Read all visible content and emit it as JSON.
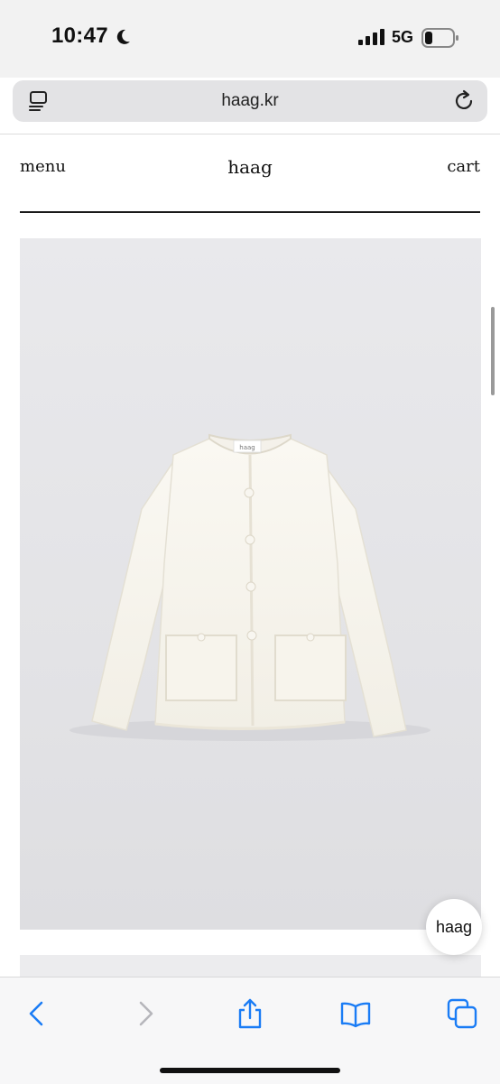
{
  "status": {
    "time": "10:47",
    "network": "5G",
    "icons": [
      "moon-icon",
      "signal-icon",
      "battery-icon"
    ]
  },
  "browser": {
    "url": "haag.kr",
    "icons": [
      "reader-mode-icon",
      "reload-icon"
    ]
  },
  "site": {
    "menu_label": "menu",
    "logo": "haag",
    "cart_label": "cart"
  },
  "product": {
    "image_subject": "white tweed jacket",
    "tag_text": "haag"
  },
  "floating_button": {
    "label": "haag"
  },
  "toolbar": {
    "icons": [
      "back-icon",
      "forward-icon",
      "share-icon",
      "bookmarks-icon",
      "tabs-icon"
    ]
  },
  "colors": {
    "accent": "#1a7cf5",
    "disabled": "#b6b6bb",
    "text": "#111111"
  }
}
